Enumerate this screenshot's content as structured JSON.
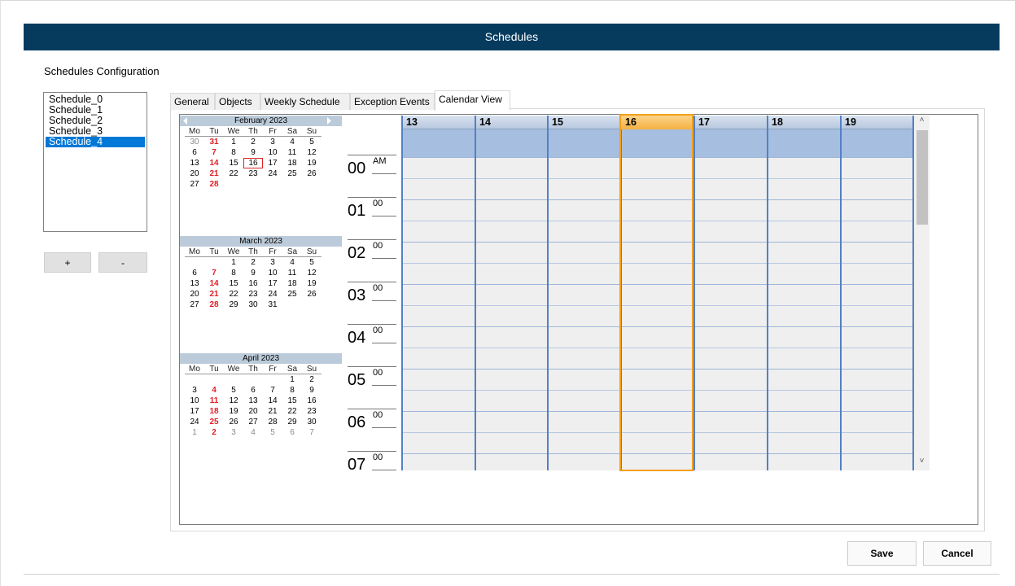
{
  "window": {
    "title": "Schedules"
  },
  "config": {
    "label": "Schedules Configuration"
  },
  "schedules": {
    "items": [
      "Schedule_0",
      "Schedule_1",
      "Schedule_2",
      "Schedule_3",
      "Schedule_4"
    ],
    "selected": "Schedule_4"
  },
  "buttons": {
    "add": "+",
    "remove": "-",
    "save": "Save",
    "cancel": "Cancel"
  },
  "tabs": [
    "General",
    "Objects",
    "Weekly Schedule",
    "Exception Events",
    "Calendar View"
  ],
  "active_tab": "Calendar View",
  "calendar": {
    "weekday_headers": [
      "Mo",
      "Tu",
      "We",
      "Th",
      "Fr",
      "Sa",
      "Su"
    ],
    "months": [
      {
        "title": "February 2023",
        "weeks": [
          [
            "30",
            "31",
            "1",
            "2",
            "3",
            "4",
            "5"
          ],
          [
            "6",
            "7",
            "8",
            "9",
            "10",
            "11",
            "12"
          ],
          [
            "13",
            "14",
            "15",
            "16",
            "17",
            "18",
            "19"
          ],
          [
            "20",
            "21",
            "22",
            "23",
            "24",
            "25",
            "26"
          ],
          [
            "27",
            "28",
            "",
            "",
            "",
            "",
            ""
          ]
        ]
      },
      {
        "title": "March 2023",
        "weeks": [
          [
            "",
            "",
            "1",
            "2",
            "3",
            "4",
            "5"
          ],
          [
            "6",
            "7",
            "8",
            "9",
            "10",
            "11",
            "12"
          ],
          [
            "13",
            "14",
            "15",
            "16",
            "17",
            "18",
            "19"
          ],
          [
            "20",
            "21",
            "22",
            "23",
            "24",
            "25",
            "26"
          ],
          [
            "27",
            "28",
            "29",
            "30",
            "31",
            "",
            ""
          ]
        ]
      },
      {
        "title": "April 2023",
        "weeks": [
          [
            "",
            "",
            "",
            "",
            "",
            "1",
            "2"
          ],
          [
            "3",
            "4",
            "5",
            "6",
            "7",
            "8",
            "9"
          ],
          [
            "10",
            "11",
            "12",
            "13",
            "14",
            "15",
            "16"
          ],
          [
            "17",
            "18",
            "19",
            "20",
            "21",
            "22",
            "23"
          ],
          [
            "24",
            "25",
            "26",
            "27",
            "28",
            "29",
            "30"
          ],
          [
            "1",
            "2",
            "3",
            "4",
            "5",
            "6",
            "7"
          ]
        ]
      }
    ],
    "today": "16"
  },
  "dayview": {
    "days": [
      "13",
      "14",
      "15",
      "16",
      "17",
      "18",
      "19"
    ],
    "selected_day": "16",
    "hours": [
      {
        "h": "00",
        "m": "AM"
      },
      {
        "h": "01",
        "m": "00"
      },
      {
        "h": "02",
        "m": "00"
      },
      {
        "h": "03",
        "m": "00"
      },
      {
        "h": "04",
        "m": "00"
      },
      {
        "h": "05",
        "m": "00"
      },
      {
        "h": "06",
        "m": "00"
      },
      {
        "h": "07",
        "m": "00"
      }
    ]
  },
  "colors": {
    "titlebar": "#063b5e",
    "selection": "#0078d7",
    "today_outline": "#f3a01c",
    "weekday_red": "#e31e24"
  }
}
